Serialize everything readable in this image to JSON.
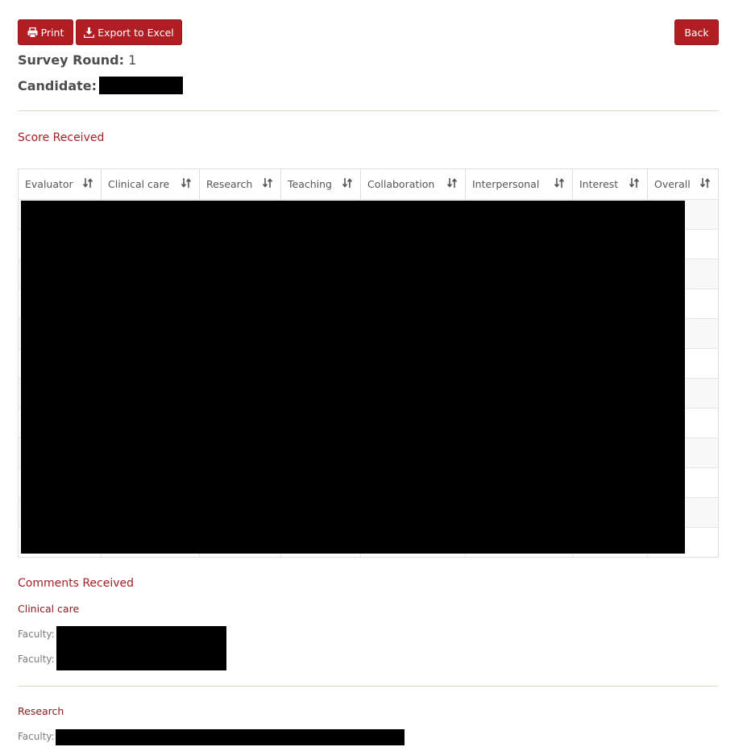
{
  "toolbar": {
    "print_label": "Print",
    "export_label": "Export to Excel",
    "back_label": "Back"
  },
  "info": {
    "survey_round_label": "Survey Round:",
    "survey_round_value": "1",
    "candidate_label": "Candidate:"
  },
  "scores": {
    "title": "Score Received",
    "columns": [
      "Evaluator",
      "Clinical care",
      "Research",
      "Teaching",
      "Collaboration",
      "Interpersonal",
      "Interest",
      "Overall"
    ]
  },
  "comments": {
    "title": "Comments Received",
    "sections": [
      {
        "title": "Clinical care",
        "entries": [
          "Faculty:",
          "Faculty:"
        ]
      },
      {
        "title": "Research",
        "entries": [
          "Faculty:"
        ]
      }
    ]
  },
  "colors": {
    "accent": "#b01e23",
    "section_title": "#a32025"
  }
}
